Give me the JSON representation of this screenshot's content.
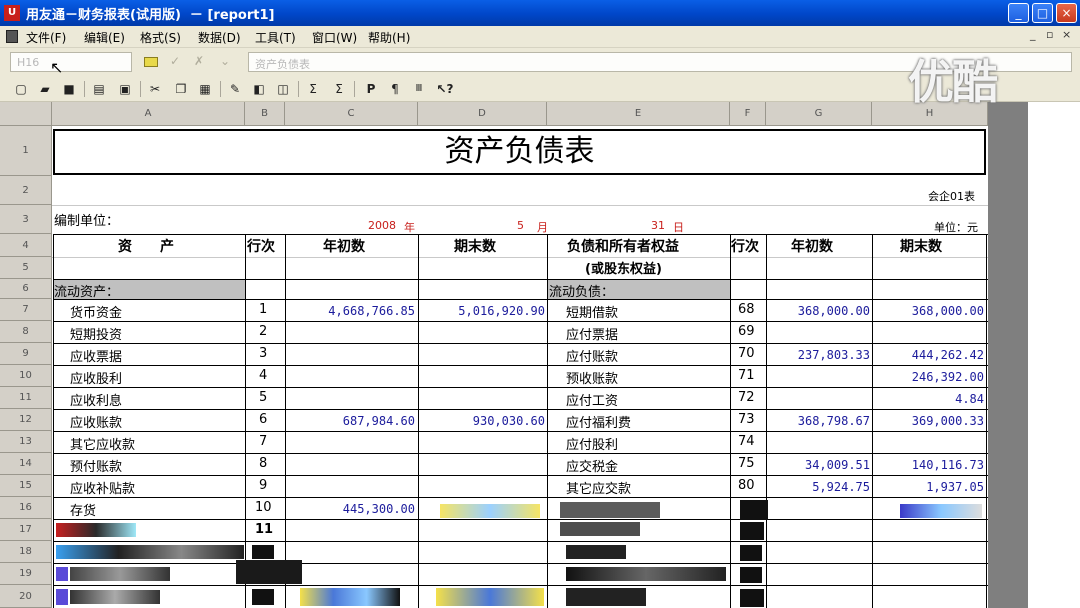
{
  "window": {
    "app_icon": "ufida-icon",
    "title": "用友通－财务报表(试用版)  － [report1]",
    "controls": [
      "_",
      "□",
      "×"
    ]
  },
  "menu": {
    "items": [
      "文件(F)",
      "编辑(E)",
      "格式(S)",
      "数据(D)",
      "工具(T)",
      "窗口(W)",
      "帮助(H)"
    ],
    "mdi_controls": [
      "_",
      "▫",
      "×"
    ]
  },
  "formula_bar": {
    "cell_ref": "H16",
    "content": "资产负债表"
  },
  "watermark": "优酷",
  "sheet": {
    "columns": [
      "A",
      "B",
      "C",
      "D",
      "E",
      "F",
      "G",
      "H"
    ],
    "row_numbers": [
      "1",
      "2",
      "3",
      "4",
      "5",
      "6",
      "7",
      "8",
      "9",
      "10",
      "11",
      "12",
      "13",
      "14",
      "15",
      "16",
      "17",
      "18",
      "19",
      "20"
    ],
    "title": "资产负债表",
    "form_code": "会企01表",
    "unit_label": "编制单位：",
    "date": {
      "year": "2008",
      "year_unit": "年",
      "month": "5",
      "month_unit": "月",
      "day": "31",
      "day_unit": "日"
    },
    "currency": "单位：元",
    "headers": {
      "asset": "资　　产",
      "line_no": "行次",
      "opening": "年初数",
      "closing": "期末数",
      "liability_line1": "负债和所有者权益",
      "liability_line2": "(或股东权益)",
      "line_no2": "行次",
      "opening2": "年初数",
      "closing2": "期末数"
    },
    "section_left": "流动资产：",
    "section_right": "流动负债：",
    "rows": [
      {
        "asset": "货币资金",
        "no": "1",
        "open": "4,668,766.85",
        "close": "5,016,920.90",
        "liab": "短期借款",
        "no2": "68",
        "open2": "368,000.00",
        "close2": "368,000.00"
      },
      {
        "asset": "短期投资",
        "no": "2",
        "open": "",
        "close": "",
        "liab": "应付票据",
        "no2": "69",
        "open2": "",
        "close2": ""
      },
      {
        "asset": "应收票据",
        "no": "3",
        "open": "",
        "close": "",
        "liab": "应付账款",
        "no2": "70",
        "open2": "237,803.33",
        "close2": "444,262.42"
      },
      {
        "asset": "应收股利",
        "no": "4",
        "open": "",
        "close": "",
        "liab": "预收账款",
        "no2": "71",
        "open2": "",
        "close2": "246,392.00"
      },
      {
        "asset": "应收利息",
        "no": "5",
        "open": "",
        "close": "",
        "liab": "应付工资",
        "no2": "72",
        "open2": "",
        "close2": "4.84"
      },
      {
        "asset": "应收账款",
        "no": "6",
        "open": "687,984.60",
        "close": "930,030.60",
        "liab": "应付福利费",
        "no2": "73",
        "open2": "368,798.67",
        "close2": "369,000.33"
      },
      {
        "asset": "其它应收款",
        "no": "7",
        "open": "",
        "close": "",
        "liab": "应付股利",
        "no2": "74",
        "open2": "",
        "close2": ""
      },
      {
        "asset": "预付账款",
        "no": "8",
        "open": "",
        "close": "",
        "liab": "应交税金",
        "no2": "75",
        "open2": "34,009.51",
        "close2": "140,116.73"
      },
      {
        "asset": "应收补贴款",
        "no": "9",
        "open": "",
        "close": "",
        "liab": "其它应交款",
        "no2": "80",
        "open2": "5,924.75",
        "close2": "1,937.05"
      },
      {
        "asset": "存货",
        "no": "10",
        "open": "445,300.00",
        "close": "",
        "liab": "",
        "no2": "",
        "open2": "",
        "close2": ""
      }
    ],
    "row_no_11": "11"
  },
  "colors": {
    "titlebar": "#0050d8",
    "chrome": "#ece9d8",
    "header_gray": "#d4d0c8",
    "number_blue": "#1c1c9c",
    "date_red": "#c8201c"
  }
}
